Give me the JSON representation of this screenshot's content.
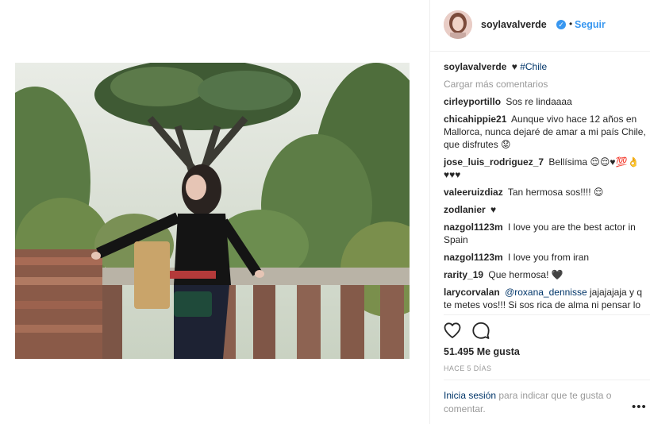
{
  "post": {
    "username": "soylavalverde",
    "follow_label": "Seguir",
    "separator": "•",
    "verified_glyph": "✓",
    "caption_text": "♥",
    "caption_tag": "#Chile",
    "load_more": "Cargar más comentarios",
    "likes": "51.495 Me gusta",
    "time": "HACE 5 DÍAS",
    "login_link": "Inicia sesión",
    "login_text": " para indicar que te gusta o comentar.",
    "more_label": "•••"
  },
  "comments": [
    {
      "user": "cirleyportillo",
      "text": "Sos re lindaaaa"
    },
    {
      "user": "chicahippie21",
      "text": "Aunque vivo hace 12 años en Mallorca, nunca dejaré de amar a mi país Chile, que disfrutes 😟"
    },
    {
      "user": "jose_luis_rodriguez_7",
      "text": "Bellísima 😌😌♥💯👌 ♥♥♥"
    },
    {
      "user": "valeeruizdiaz",
      "text": "Tan hermosa sos!!!! 😌"
    },
    {
      "user": "zodlanier",
      "text": "♥"
    },
    {
      "user": "nazgol1123m",
      "text": "I love you are the best actor in Spain"
    },
    {
      "user": "nazgol1123m",
      "text": "I love you from iran"
    },
    {
      "user": "rarity_19",
      "text": "Que hermosa! 🖤"
    },
    {
      "user": "larycorvalan",
      "mention": "@roxana_dennisse",
      "text": " jajajajaja y q te metes vos!!! Si sos rica de alma ni pensar lo que te vas a"
    }
  ],
  "icons": {
    "heart": "heart-icon",
    "comment": "comment-icon",
    "verified": "verified-badge-icon"
  },
  "colors": {
    "link_blue": "#3897f0",
    "mention_blue": "#003569",
    "muted": "#999999",
    "text": "#262626"
  }
}
